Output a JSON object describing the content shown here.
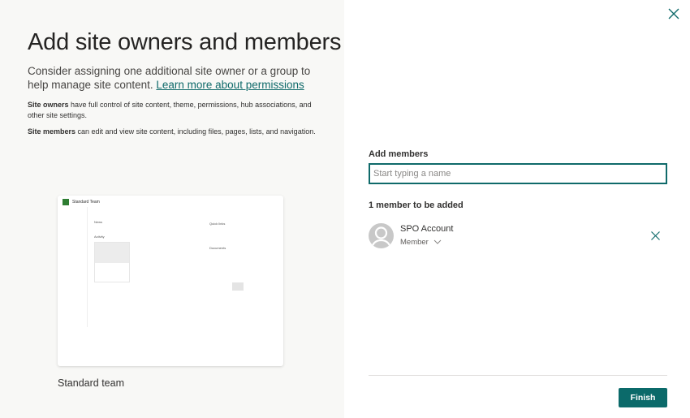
{
  "left": {
    "title": "Add site owners and members",
    "intro": "Consider assigning one additional site owner or a group to help manage site content.",
    "learn_more_link": "Learn more about permissions",
    "owners_bold": "Site owners",
    "owners_text": " have full control of site content, theme, permissions, hub associations, and other site settings.",
    "members_bold": "Site members",
    "members_text": " can edit and view site content, including files, pages, lists, and navigation.",
    "preview": {
      "site_name": "Standard Team",
      "news": "News",
      "activity": "Activity",
      "quick_links": "Quick links",
      "documents": "Documents"
    },
    "template_label": "Standard team"
  },
  "right": {
    "close_icon": "close-icon",
    "add_members_label": "Add members",
    "input_placeholder": "Start typing a name",
    "input_value": "",
    "count_label": "1 member to be added",
    "members": [
      {
        "name": "SPO Account",
        "role": "Member"
      }
    ],
    "finish_label": "Finish"
  },
  "colors": {
    "accent": "#0f6a6a",
    "left_bg": "#f8f8f6"
  }
}
